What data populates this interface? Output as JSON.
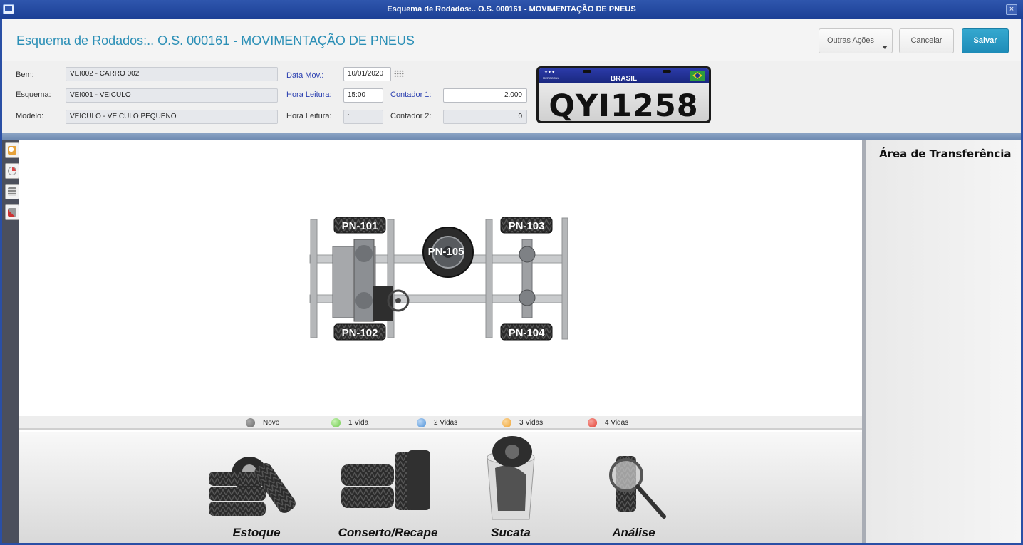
{
  "window": {
    "title": "Esquema de Rodados:.. O.S. 000161 - MOVIMENTAÇÃO DE PNEUS",
    "close_glyph": "×"
  },
  "header": {
    "title": "Esquema de Rodados:.. O.S. 000161 - MOVIMENTAÇÃO DE PNEUS",
    "buttons": {
      "outras": "Outras Ações",
      "cancelar": "Cancelar",
      "salvar": "Salvar"
    }
  },
  "form": {
    "bem": {
      "label": "Bem:",
      "value": "VEI002 - CARRO 002"
    },
    "esquema": {
      "label": "Esquema:",
      "value": "VEI001 - VEICULO"
    },
    "modelo": {
      "label": "Modelo:",
      "value": "VEICULO - VEICULO PEQUENO"
    },
    "data_mov": {
      "label": "Data Mov.:",
      "value": "10/01/2020"
    },
    "hora_leitura_1": {
      "label": "Hora Leitura:",
      "value": "15:00"
    },
    "hora_leitura_2": {
      "label": "Hora Leitura:",
      "value": ":"
    },
    "contador_1": {
      "label": "Contador 1:",
      "value": "2.000"
    },
    "contador_2": {
      "label": "Contador 2:",
      "value": "0"
    }
  },
  "plate": {
    "country": "BRASIL",
    "bloc": "MERCOSUL",
    "number": "QYI1258"
  },
  "diagram": {
    "tires": {
      "pn101": "PN-101",
      "pn102": "PN-102",
      "pn103": "PN-103",
      "pn104": "PN-104",
      "pn105": "PN-105"
    }
  },
  "legend": [
    {
      "label": "Novo",
      "color": "#6b6b6b"
    },
    {
      "label": "1 Vida",
      "color": "#6cc94a"
    },
    {
      "label": "2 Vidas",
      "color": "#4b8fd6"
    },
    {
      "label": "3 Vidas",
      "color": "#f0a330"
    },
    {
      "label": "4 Vidas",
      "color": "#e23b2e"
    }
  ],
  "actions": {
    "estoque": "Estoque",
    "conserto": "Conserto/Recape",
    "sucata": "Sucata",
    "analise": "Análise"
  },
  "transfer": {
    "title": "Área de Transferência"
  },
  "toolbar_icons": [
    "search-doc-icon",
    "gauge-icon",
    "stack-icon",
    "tool-icon"
  ],
  "colors": {
    "accent": "#2b8fb6",
    "titlebar": "#2f56ad",
    "save": "#1e8cb8"
  }
}
